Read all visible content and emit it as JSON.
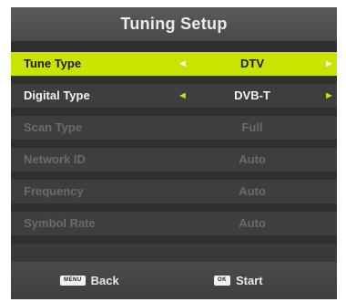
{
  "header": {
    "title": "Tuning Setup"
  },
  "rows": [
    {
      "label": "Tune Type",
      "value": "DTV",
      "state": "selected",
      "arrows": true
    },
    {
      "label": "Digital Type",
      "value": "DVB-T",
      "state": "active",
      "arrows": true
    },
    {
      "label": "Scan Type",
      "value": "Full",
      "state": "disabled",
      "arrows": false
    },
    {
      "label": "Network ID",
      "value": "Auto",
      "state": "disabled",
      "arrows": false
    },
    {
      "label": "Frequency",
      "value": "Auto",
      "state": "disabled",
      "arrows": false
    },
    {
      "label": "Symbol Rate",
      "value": "Auto",
      "state": "disabled",
      "arrows": false
    }
  ],
  "arrows": {
    "left": "◄",
    "right": "►"
  },
  "footer": {
    "back_key": "MENU",
    "back_label": "Back",
    "start_key": "OK",
    "start_label": "Start"
  },
  "colors": {
    "highlight": "#c8e400",
    "panel": "#2f2f2f",
    "row": "#3e3e3e",
    "disabled_text": "#6b6b6b"
  },
  "icons": {
    "left": "arrow-left-icon",
    "right": "arrow-right-icon"
  }
}
